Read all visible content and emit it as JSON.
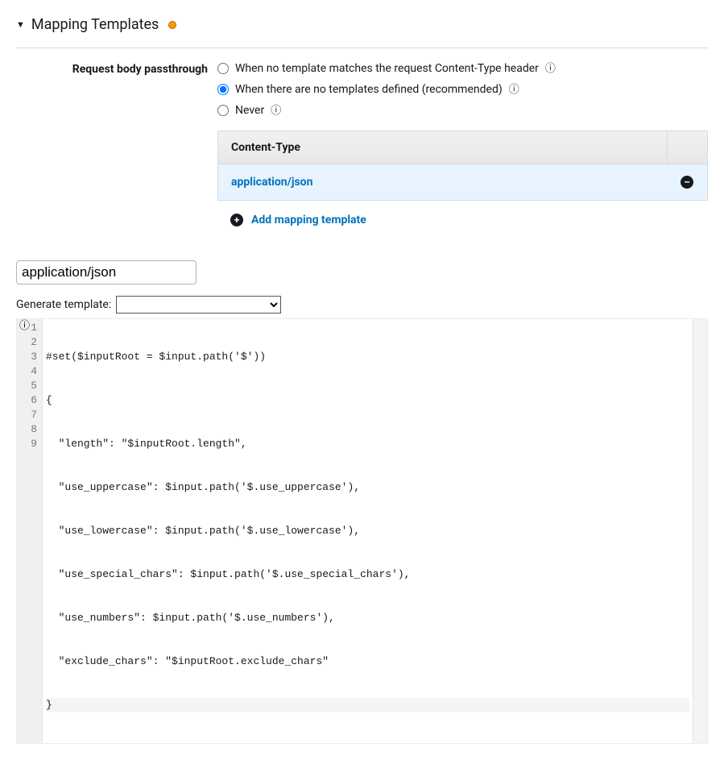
{
  "section": {
    "title": "Mapping Templates"
  },
  "passthrough": {
    "label": "Request body passthrough",
    "options": [
      "When no template matches the request Content-Type header",
      "When there are no templates defined (recommended)",
      "Never"
    ]
  },
  "content_type_table": {
    "header": "Content-Type",
    "row_name": "application/json",
    "add_label": "Add mapping template"
  },
  "editor": {
    "input_value": "application/json",
    "generate_label": "Generate template:",
    "code_lines": [
      "#set($inputRoot = $input.path('$'))",
      "{",
      "  \"length\": \"$inputRoot.length\",",
      "  \"use_uppercase\": $input.path('$.use_uppercase'),",
      "  \"use_lowercase\": $input.path('$.use_lowercase'),",
      "  \"use_special_chars\": $input.path('$.use_special_chars'),",
      "  \"use_numbers\": $input.path('$.use_numbers'),",
      "  \"exclude_chars\": \"$inputRoot.exclude_chars\"",
      "}"
    ]
  }
}
